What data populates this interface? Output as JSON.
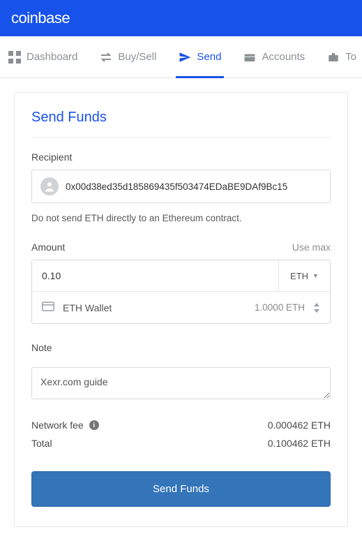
{
  "brand": "coinbase",
  "nav": {
    "dashboard": "Dashboard",
    "buysell": "Buy/Sell",
    "send": "Send",
    "accounts": "Accounts",
    "tools": "To"
  },
  "card": {
    "title": "Send Funds",
    "recipient_label": "Recipient",
    "recipient_value": "0x00d38ed35d185869435f503474EDaBE9DAf9Bc15",
    "recipient_hint": "Do not send ETH directly to an Ethereum contract.",
    "amount_label": "Amount",
    "use_max": "Use max",
    "amount_value": "0.10",
    "currency": "ETH",
    "wallet_name": "ETH Wallet",
    "wallet_balance": "1.0000 ETH",
    "note_label": "Note",
    "note_value": "Xexr.com guide",
    "fee_label": "Network fee",
    "fee_value": "0.000462 ETH",
    "total_label": "Total",
    "total_value": "0.100462 ETH",
    "submit": "Send Funds"
  }
}
